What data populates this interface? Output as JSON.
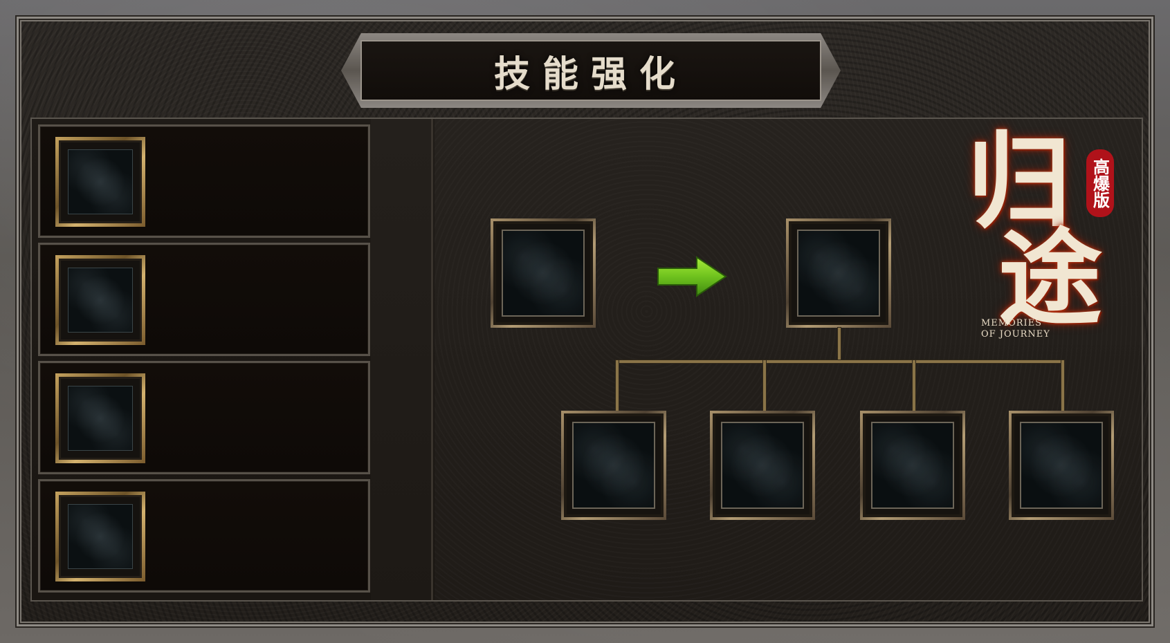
{
  "window": {
    "title": "技能强化"
  },
  "skill_list": {
    "items": [
      {
        "slot_icon": "empty-skill-slot-icon"
      },
      {
        "slot_icon": "empty-skill-slot-icon"
      },
      {
        "slot_icon": "empty-skill-slot-icon"
      },
      {
        "slot_icon": "empty-skill-slot-icon"
      }
    ]
  },
  "upgrade": {
    "arrow_icon": "green-arrow-right-icon",
    "arrow_color": "#6fc21e"
  },
  "logo": {
    "name": "归途",
    "badge": "高爆版",
    "english_line1": "MEMORIES",
    "english_line2": "OF JOURNEY"
  },
  "colors": {
    "gold_frame": "#c5a25e",
    "panel_bg": "#120d09",
    "title_text": "#e5dccb"
  }
}
